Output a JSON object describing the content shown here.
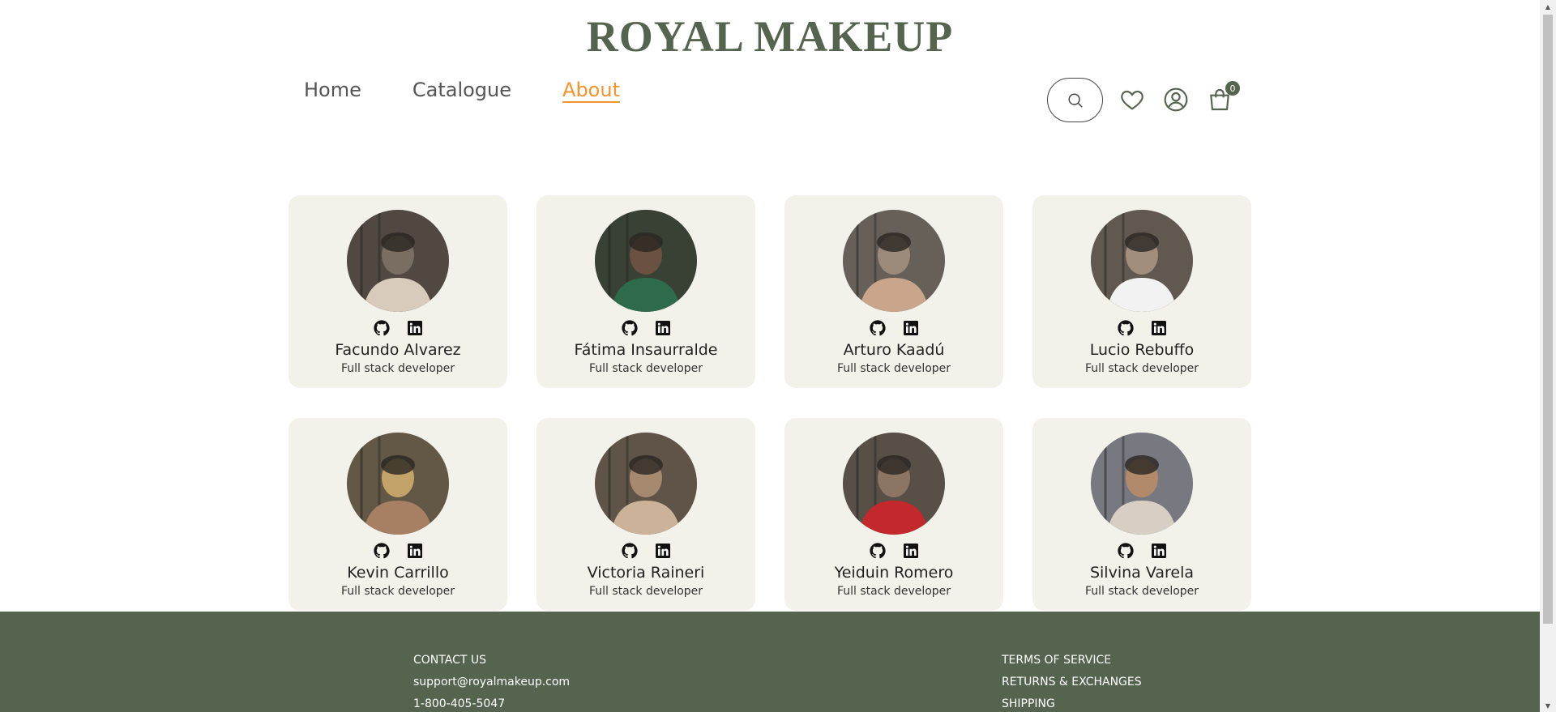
{
  "brand": {
    "title": "ROYAL MAKEUP"
  },
  "nav": {
    "items": [
      {
        "label": "Home",
        "active": false
      },
      {
        "label": "Catalogue",
        "active": false
      },
      {
        "label": "About",
        "active": true
      }
    ]
  },
  "header_actions": {
    "cart_count": "0"
  },
  "team": {
    "members": [
      {
        "name": "Facundo Alvarez",
        "role": "Full stack developer",
        "photo_palette": [
          "#3a3531",
          "#d9cbbb",
          "#7a6e62"
        ]
      },
      {
        "name": "Fátima Insaurralde",
        "role": "Full stack developer",
        "photo_palette": [
          "#1f3a2d",
          "#2e6b4a",
          "#6b5142"
        ]
      },
      {
        "name": "Arturo Kaadú",
        "role": "Full stack developer",
        "photo_palette": [
          "#4b4a48",
          "#c9a58c",
          "#9c8a7b"
        ]
      },
      {
        "name": "Lucio Rebuffo",
        "role": "Full stack developer",
        "photo_palette": [
          "#3e3c39",
          "#f2f2f2",
          "#a28e7c"
        ]
      },
      {
        "name": "Kevin Carrillo",
        "role": "Full stack developer",
        "photo_palette": [
          "#2f3032",
          "#a77f63",
          "#c4a36a"
        ]
      },
      {
        "name": "Victoria Raineri",
        "role": "Full stack developer",
        "photo_palette": [
          "#3b3834",
          "#cdb29a",
          "#a58a70"
        ]
      },
      {
        "name": "Yeiduin Romero",
        "role": "Full stack developer",
        "photo_palette": [
          "#3d3b38",
          "#c2282c",
          "#8c7663"
        ]
      },
      {
        "name": "Silvina Varela",
        "role": "Full stack developer",
        "photo_palette": [
          "#5b6f8c",
          "#d8cfc4",
          "#b08a6a"
        ]
      }
    ]
  },
  "footer": {
    "left": [
      "CONTACT US",
      "support@royalmakeup.com",
      "1-800-405-5047"
    ],
    "right": [
      "TERMS OF SERVICE",
      "RETURNS & EXCHANGES",
      "SHIPPING"
    ]
  },
  "colors": {
    "brand": "#55644f",
    "accent": "#f0952f",
    "card_bg": "#f3f2ea"
  }
}
